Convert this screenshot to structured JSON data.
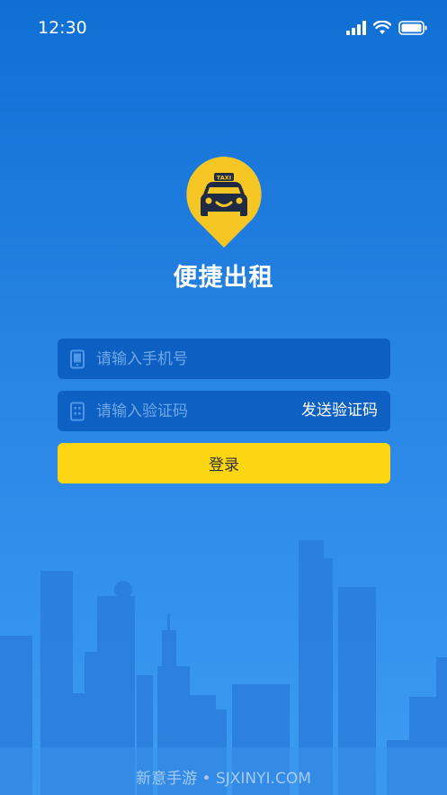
{
  "status_bar": {
    "time": "12:30",
    "icons": [
      "signal-icon",
      "wifi-icon",
      "battery-icon"
    ]
  },
  "app": {
    "title": "便捷出租",
    "logo_badge_text": "TAXI"
  },
  "form": {
    "phone_placeholder": "请输入手机号",
    "code_placeholder": "请输入验证码",
    "send_code_label": "发送验证码",
    "login_label": "登录"
  },
  "footer": {
    "watermark": "新意手游 • SJXINYI.COM"
  },
  "colors": {
    "background_top": "#0f6fd3",
    "background_bottom": "#3e9cf2",
    "field_bg": "#0656b8",
    "accent_yellow": "#fcd612",
    "placeholder": "#6fa8e6"
  }
}
